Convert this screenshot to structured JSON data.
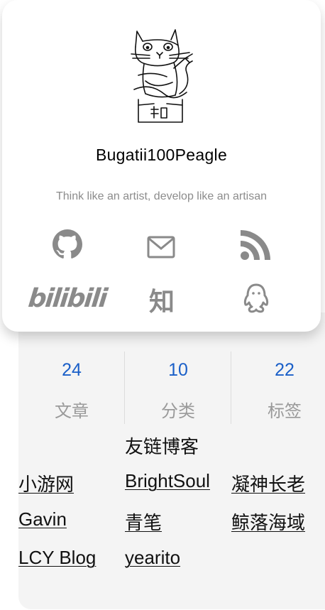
{
  "profile": {
    "name": "Bugatii100Peagle",
    "motto": "Think like an artist, develop like an artisan"
  },
  "social": [
    {
      "icon": "github-icon"
    },
    {
      "icon": "mail-icon"
    },
    {
      "icon": "rss-icon"
    },
    {
      "icon": "bilibili-icon",
      "text": "bilibili"
    },
    {
      "icon": "zhihu-icon",
      "text": "知"
    },
    {
      "icon": "qq-icon"
    }
  ],
  "stats": [
    {
      "value": "24",
      "label": "文章"
    },
    {
      "value": "10",
      "label": "分类"
    },
    {
      "value": "22",
      "label": "标签"
    }
  ],
  "friends": {
    "title": "友链博客",
    "links": [
      "小游网",
      "BrightSoul",
      "凝神长老",
      "Gavin",
      "青笔",
      "鲸落海域",
      "LCY Blog",
      "yearito"
    ]
  },
  "colors": {
    "accent": "#1a5fc8",
    "icon": "#8a8a8a",
    "panel": "#f4f4f4"
  }
}
